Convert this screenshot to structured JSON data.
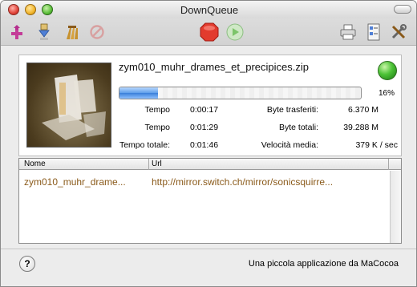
{
  "window": {
    "title": "DownQueue"
  },
  "toolbar": {
    "icons": [
      "add-download-icon",
      "download-icon",
      "clean-broom-icon",
      "cancel-icon",
      "stop-icon",
      "play-icon",
      "print-icon",
      "preferences-icon",
      "tools-icon"
    ]
  },
  "download": {
    "filename": "zym010_muhr_drames_et_precipices.zip",
    "progress_percent": 16,
    "percent_label": "16%",
    "stats": {
      "tempo_label": "Tempo",
      "tempo_value": "0:00:17",
      "tempo2_label": "Tempo",
      "tempo2_value": "0:01:29",
      "tempo_totale_label": "Tempo totale:",
      "tempo_totale_value": "0:01:46",
      "byte_trasferiti_label": "Byte trasferiti:",
      "byte_trasferiti_value": "6.370 M",
      "byte_totali_label": "Byte totali:",
      "byte_totali_value": "39.288 M",
      "velocita_label": "Velocità media:",
      "velocita_value": "379 K / sec"
    }
  },
  "table": {
    "columns": [
      "Nome",
      "Url"
    ],
    "rows": [
      {
        "nome": "zym010_muhr_drame...",
        "url": "http://mirror.switch.ch/mirror/sonicsquirre..."
      }
    ]
  },
  "footer": {
    "help_label": "?",
    "credit": "Una piccola applicazione da MaCocoa"
  },
  "colors": {
    "progress": "#3a7fd9",
    "row_text": "#8a5a1a",
    "stop": "#e23b2e",
    "play": "#7cc46a"
  }
}
